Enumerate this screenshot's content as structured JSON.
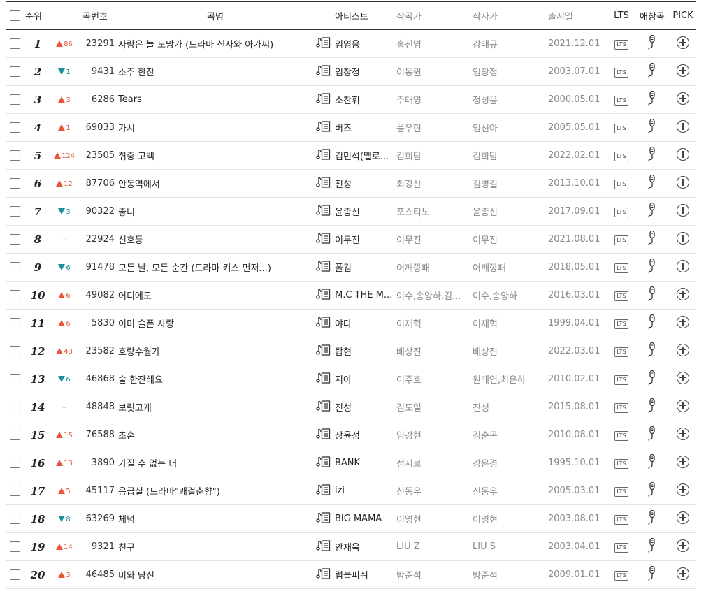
{
  "headers": {
    "rank": "순위",
    "number": "곡번호",
    "title": "곡명",
    "artist": "아티스트",
    "composer": "작곡가",
    "lyricist": "작사가",
    "date": "출시일",
    "lts": "LTS",
    "favorite": "애창곡",
    "pick": "PICK"
  },
  "lts_label": "LTS",
  "colors": {
    "up": "#e8553a",
    "down": "#1c8f9a"
  },
  "rows": [
    {
      "rank": "1",
      "dir": "up",
      "change": "86",
      "number": "23291",
      "title": "사랑은 늘 도망가 (드라마 신사와 아가씨)",
      "artist": "임영웅",
      "composer": "홍진영",
      "lyricist": "강태규",
      "date": "2021.12.01"
    },
    {
      "rank": "2",
      "dir": "down",
      "change": "1",
      "number": "9431",
      "title": "소주 한잔",
      "artist": "임창정",
      "composer": "이동원",
      "lyricist": "임창정",
      "date": "2003.07.01"
    },
    {
      "rank": "3",
      "dir": "up",
      "change": "3",
      "number": "6286",
      "title": "Tears",
      "artist": "소찬휘",
      "composer": "주태영",
      "lyricist": "정성윤",
      "date": "2000.05.01"
    },
    {
      "rank": "4",
      "dir": "up",
      "change": "1",
      "number": "69033",
      "title": "가시",
      "artist": "버즈",
      "composer": "윤우현",
      "lyricist": "임선아",
      "date": "2005.05.01"
    },
    {
      "rank": "5",
      "dir": "up",
      "change": "124",
      "number": "23505",
      "title": "취중 고백",
      "artist": "김민석(멜로...",
      "composer": "김희탐",
      "lyricist": "김희탐",
      "date": "2022.02.01"
    },
    {
      "rank": "6",
      "dir": "up",
      "change": "12",
      "number": "87706",
      "title": "안동역에서",
      "artist": "진성",
      "composer": "최강산",
      "lyricist": "김병걸",
      "date": "2013.10.01"
    },
    {
      "rank": "7",
      "dir": "down",
      "change": "3",
      "number": "90322",
      "title": "좋니",
      "artist": "윤종신",
      "composer": "포스티노",
      "lyricist": "윤종신",
      "date": "2017.09.01"
    },
    {
      "rank": "8",
      "dir": "same",
      "change": "–",
      "number": "22924",
      "title": "신호등",
      "artist": "이무진",
      "composer": "이무진",
      "lyricist": "이무진",
      "date": "2021.08.01"
    },
    {
      "rank": "9",
      "dir": "down",
      "change": "6",
      "number": "91478",
      "title": "모든 날, 모든 순간 (드라마 키스 먼저...)",
      "artist": "폴킴",
      "composer": "어깨깡패",
      "lyricist": "어깨깡패",
      "date": "2018.05.01"
    },
    {
      "rank": "10",
      "dir": "up",
      "change": "6",
      "number": "49082",
      "title": "어디에도",
      "artist": "M.C THE M...",
      "composer": "이수,송양하,김...",
      "lyricist": "이수,송양하",
      "date": "2016.03.01"
    },
    {
      "rank": "11",
      "dir": "up",
      "change": "6",
      "number": "5830",
      "title": "이미 슬픈 사랑",
      "artist": "야다",
      "composer": "이재혁",
      "lyricist": "이재혁",
      "date": "1999.04.01"
    },
    {
      "rank": "12",
      "dir": "up",
      "change": "43",
      "number": "23582",
      "title": "호랑수월가",
      "artist": "탑현",
      "composer": "배상진",
      "lyricist": "배상진",
      "date": "2022.03.01"
    },
    {
      "rank": "13",
      "dir": "down",
      "change": "6",
      "number": "46868",
      "title": "술 한잔해요",
      "artist": "지아",
      "composer": "이주호",
      "lyricist": "원태연,최은하",
      "date": "2010.02.01"
    },
    {
      "rank": "14",
      "dir": "same",
      "change": "–",
      "number": "48848",
      "title": "보릿고개",
      "artist": "진성",
      "composer": "김도일",
      "lyricist": "진성",
      "date": "2015.08.01"
    },
    {
      "rank": "15",
      "dir": "up",
      "change": "15",
      "number": "76588",
      "title": "초혼",
      "artist": "장윤정",
      "composer": "임강현",
      "lyricist": "김순곤",
      "date": "2010.08.01"
    },
    {
      "rank": "16",
      "dir": "up",
      "change": "13",
      "number": "3890",
      "title": "가질 수 없는 너",
      "artist": "BANK",
      "composer": "정시로",
      "lyricist": "강은경",
      "date": "1995.10.01"
    },
    {
      "rank": "17",
      "dir": "up",
      "change": "5",
      "number": "45117",
      "title": "응급실 (드라마\"쾌걸춘향\")",
      "artist": "izi",
      "composer": "신동우",
      "lyricist": "신동우",
      "date": "2005.03.01"
    },
    {
      "rank": "18",
      "dir": "down",
      "change": "8",
      "number": "63269",
      "title": "체념",
      "artist": "BIG MAMA",
      "composer": "이영현",
      "lyricist": "이영현",
      "date": "2003.08.01"
    },
    {
      "rank": "19",
      "dir": "up",
      "change": "14",
      "number": "9321",
      "title": "친구",
      "artist": "안재욱",
      "composer": "LIU Z",
      "lyricist": "LIU S",
      "date": "2003.04.01"
    },
    {
      "rank": "20",
      "dir": "up",
      "change": "3",
      "number": "46485",
      "title": "비와 당신",
      "artist": "럼블피쉬",
      "composer": "방준석",
      "lyricist": "방준석",
      "date": "2009.01.01"
    }
  ]
}
